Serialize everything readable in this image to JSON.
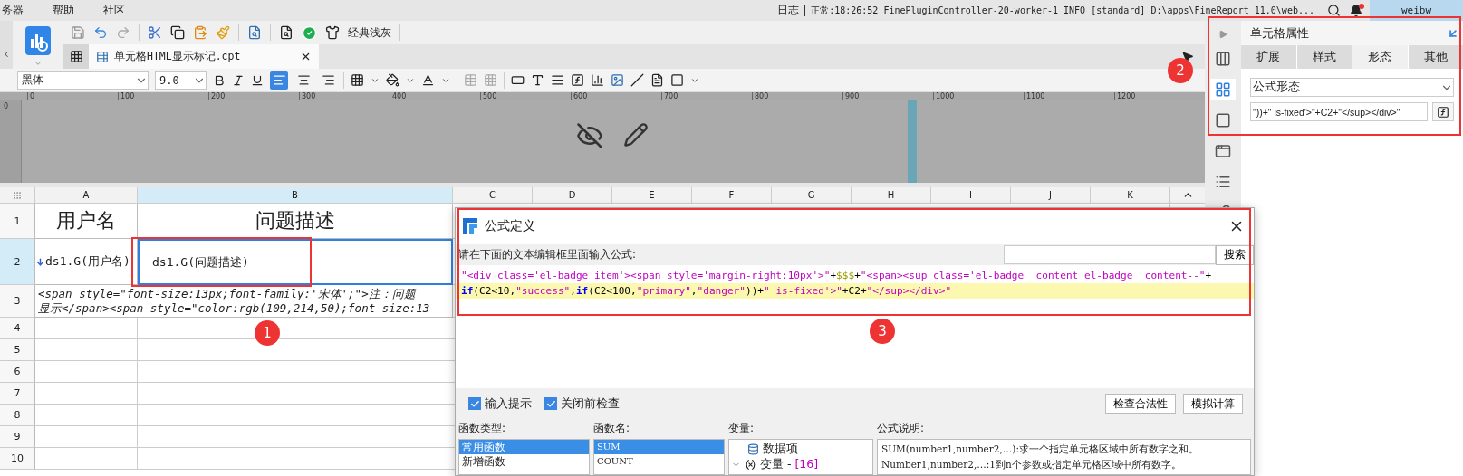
{
  "menu": [
    {
      "label": "务器"
    },
    {
      "label": "帮助"
    },
    {
      "label": "社区"
    }
  ],
  "status": {
    "log": "日志",
    "message": "正常:18:26:52 FinePluginController-20-worker-1 INFO [standard] D:\\apps\\FineReport 11.0\\web...",
    "has_notification": true,
    "user": "weibw"
  },
  "toolbar": {
    "theme": "经典浅灰"
  },
  "tab": {
    "label": "单元格HTML显示标记.cpt"
  },
  "format_bar": {
    "font": "黑体",
    "size": "9.0",
    "alignments": [
      {
        "kind": "left",
        "selected": true
      },
      {
        "kind": "center",
        "selected": false
      },
      {
        "kind": "right",
        "selected": false
      }
    ]
  },
  "vertical_ruler": "0",
  "ruler": [
    "0",
    "100",
    "200",
    "300",
    "400",
    "500",
    "600",
    "700",
    "800",
    "900",
    "1000",
    "1100",
    "1200"
  ],
  "sheet": {
    "columns": [
      {
        "label": "A",
        "selected": false
      },
      {
        "label": "B",
        "selected": true
      },
      {
        "label": "C",
        "selected": false
      },
      {
        "label": "D",
        "selected": false
      },
      {
        "label": "E",
        "selected": false
      },
      {
        "label": "F",
        "selected": false
      },
      {
        "label": "G",
        "selected": false
      },
      {
        "label": "H",
        "selected": false
      },
      {
        "label": "I",
        "selected": false
      },
      {
        "label": "J",
        "selected": false
      },
      {
        "label": "K",
        "selected": false
      }
    ],
    "rows": [
      {
        "label": "1",
        "kind": "heading",
        "selected": false,
        "cells": [
          {
            "text": "用户名",
            "selected": false
          },
          {
            "text": "问题描述",
            "selected": false
          }
        ]
      },
      {
        "label": "2",
        "kind": "fields",
        "selected": true,
        "cells": [
          {
            "text": "ds1.G(用户名)",
            "selected": false,
            "expand_down": true
          },
          {
            "text": "ds1.G(问题描述)",
            "selected": true,
            "expand_down": false
          }
        ]
      },
      {
        "label": "3",
        "kind": "note",
        "selected": false,
        "lines": [
          "<span style=\"font-size:13px;font-family:'宋体';\">注：问题",
          "显示</span><span style=\"color:rgb(109,214,50);font-size:13"
        ]
      },
      {
        "label": "4",
        "kind": "empty",
        "selected": false
      },
      {
        "label": "5",
        "kind": "empty",
        "selected": false
      },
      {
        "label": "6",
        "kind": "empty",
        "selected": false
      },
      {
        "label": "7",
        "kind": "empty",
        "selected": false
      },
      {
        "label": "8",
        "kind": "empty",
        "selected": false
      },
      {
        "label": "9",
        "kind": "empty",
        "selected": false
      },
      {
        "label": "10",
        "kind": "empty",
        "selected": false
      }
    ]
  },
  "properties": {
    "title": "单元格属性",
    "tabs": [
      {
        "label": "扩展",
        "selected": false
      },
      {
        "label": "样式",
        "selected": false
      },
      {
        "label": "形态",
        "selected": true
      },
      {
        "label": "其他",
        "selected": false
      }
    ],
    "presentation": "公式形态",
    "formula": "\"))+\" is-fixed'>\"+C2+\"</sup></div>\""
  },
  "dialog": {
    "title": "公式定义",
    "prompt": "请在下面的文本编辑框里面输入公式:",
    "search_button": "搜索",
    "code": [
      {
        "highlighted": false,
        "tokens": [
          {
            "kind": "string",
            "text": "\"<div class='el-badge item'><span style='margin-right:10px'>\""
          },
          {
            "kind": "plain",
            "text": "+"
          },
          {
            "kind": "variable",
            "text": "$$$"
          },
          {
            "kind": "plain",
            "text": "+"
          },
          {
            "kind": "string",
            "text": "\"<span><sup class='el-badge__content el-badge__content--\""
          },
          {
            "kind": "plain",
            "text": "+"
          }
        ]
      },
      {
        "highlighted": true,
        "tokens": [
          {
            "kind": "keyword",
            "text": "if"
          },
          {
            "kind": "plain",
            "text": "(C2<10,"
          },
          {
            "kind": "string",
            "text": "\"success\""
          },
          {
            "kind": "plain",
            "text": ","
          },
          {
            "kind": "keyword",
            "text": "if"
          },
          {
            "kind": "plain",
            "text": "(C2<100,"
          },
          {
            "kind": "string",
            "text": "\"primary\""
          },
          {
            "kind": "plain",
            "text": ","
          },
          {
            "kind": "string",
            "text": "\"danger\""
          },
          {
            "kind": "plain",
            "text": "))+"
          },
          {
            "kind": "string",
            "text": "\" is-fixed'>\""
          },
          {
            "kind": "plain",
            "text": "+C2+"
          },
          {
            "kind": "string",
            "text": "\"</sup></div>\""
          }
        ]
      }
    ],
    "options": [
      {
        "label": "输入提示",
        "checked": true
      },
      {
        "label": "关闭前检查",
        "checked": true
      }
    ],
    "buttons": [
      "检查合法性",
      "模拟计算"
    ],
    "function_types": {
      "label": "函数类型:",
      "items": [
        {
          "label": "常用函数",
          "selected": true
        },
        {
          "label": "新增函数",
          "selected": false
        }
      ]
    },
    "function_names": {
      "label": "函数名:",
      "items": [
        {
          "label": "SUM",
          "selected": true
        },
        {
          "label": "COUNT",
          "selected": false
        }
      ]
    },
    "variables": {
      "label": "变量:",
      "items": [
        {
          "label": "数据项"
        },
        {
          "label": "变量 - ",
          "count": "[16]",
          "expanded": true
        }
      ]
    },
    "description": {
      "label": "公式说明:",
      "lines": [
        "SUM(number1,number2,…):求一个指定单元格区域中所有数字之和。",
        "Number1,number2,…:1到n个参数或指定单元格区域中所有数字。"
      ]
    }
  },
  "annotations": [
    {
      "label": "1"
    },
    {
      "label": "2"
    },
    {
      "label": "3"
    }
  ]
}
